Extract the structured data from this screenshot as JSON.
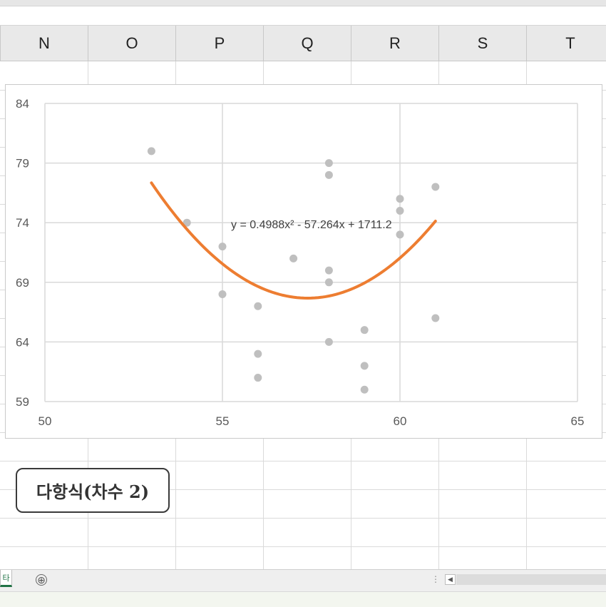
{
  "columns": [
    "N",
    "O",
    "P",
    "Q",
    "R",
    "S",
    "T"
  ],
  "label_box": {
    "text": "다항식(차수 2)"
  },
  "sheet_tab": {
    "label": "타"
  },
  "tabbar": {
    "add_symbol": "⊕",
    "dots": "⋮",
    "scroll_left": "◀"
  },
  "colors": {
    "points": "#bfbfbf",
    "trendline": "#ed7d31",
    "gridline": "#d9d9d9",
    "accent": "#217346"
  },
  "chart_data": {
    "type": "scatter",
    "x_ticks": [
      "50",
      "55",
      "60",
      "65"
    ],
    "y_ticks": [
      "84",
      "79",
      "74",
      "69",
      "64",
      "59"
    ],
    "xlim": [
      50,
      65
    ],
    "ylim": [
      59,
      84
    ],
    "grid": true,
    "points": [
      {
        "x": 53,
        "y": 80
      },
      {
        "x": 54,
        "y": 74
      },
      {
        "x": 55,
        "y": 72
      },
      {
        "x": 55,
        "y": 68
      },
      {
        "x": 56,
        "y": 67
      },
      {
        "x": 56,
        "y": 63
      },
      {
        "x": 56,
        "y": 61
      },
      {
        "x": 57,
        "y": 71
      },
      {
        "x": 58,
        "y": 79
      },
      {
        "x": 58,
        "y": 78
      },
      {
        "x": 58,
        "y": 70
      },
      {
        "x": 58,
        "y": 69
      },
      {
        "x": 58,
        "y": 64
      },
      {
        "x": 59,
        "y": 65
      },
      {
        "x": 59,
        "y": 62
      },
      {
        "x": 59,
        "y": 60
      },
      {
        "x": 60,
        "y": 76
      },
      {
        "x": 60,
        "y": 75
      },
      {
        "x": 60,
        "y": 73
      },
      {
        "x": 61,
        "y": 77
      },
      {
        "x": 61,
        "y": 66
      }
    ],
    "trendline": {
      "type": "polynomial",
      "order": 2,
      "coefficients": [
        0.4988,
        -57.264,
        1711.2
      ],
      "x_range": [
        53,
        61
      ],
      "equation_label": "y = 0.4988x² - 57.264x + 1711.2"
    }
  }
}
